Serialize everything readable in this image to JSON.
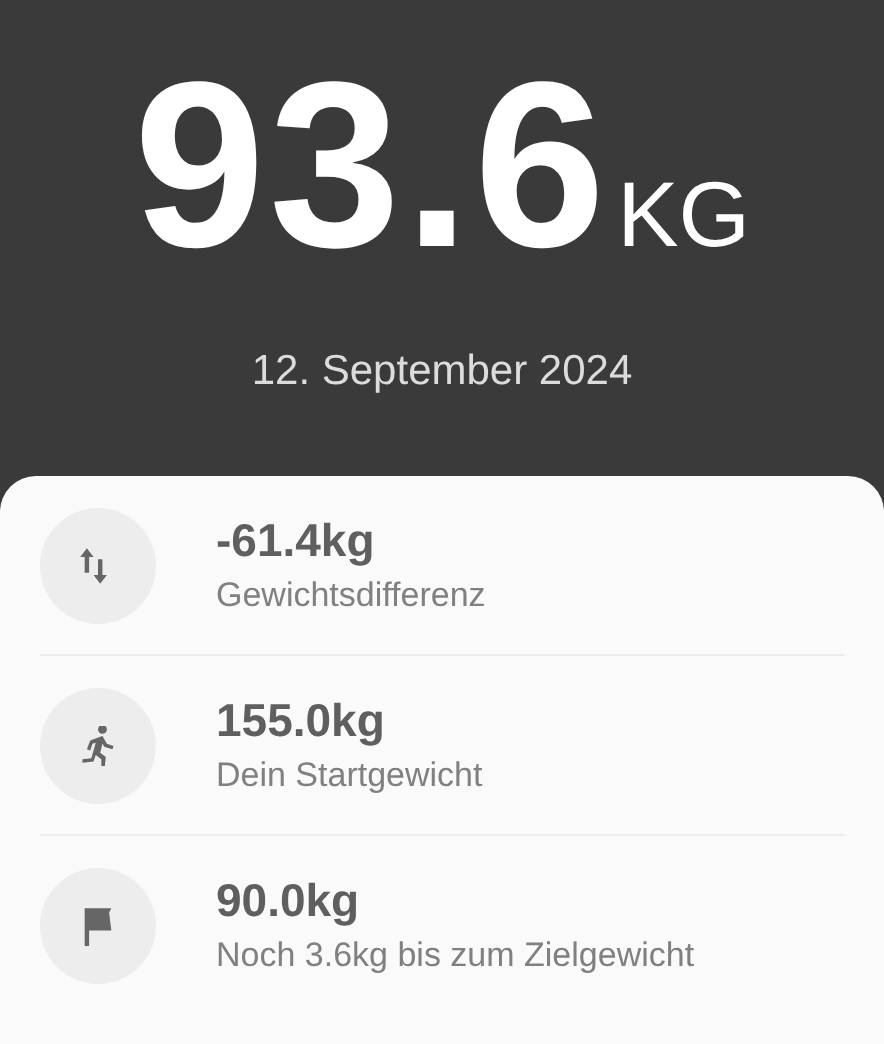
{
  "current_weight": {
    "value": "93.6",
    "unit": "KG",
    "date": "12. September 2024"
  },
  "stats": [
    {
      "kind": "difference",
      "value": "-61.4kg",
      "label": "Gewichtsdifferenz"
    },
    {
      "kind": "start",
      "value": "155.0kg",
      "label": "Dein Startgewicht"
    },
    {
      "kind": "goal",
      "value": "90.0kg",
      "label": "Noch 3.6kg bis zum Zielgewicht"
    }
  ]
}
